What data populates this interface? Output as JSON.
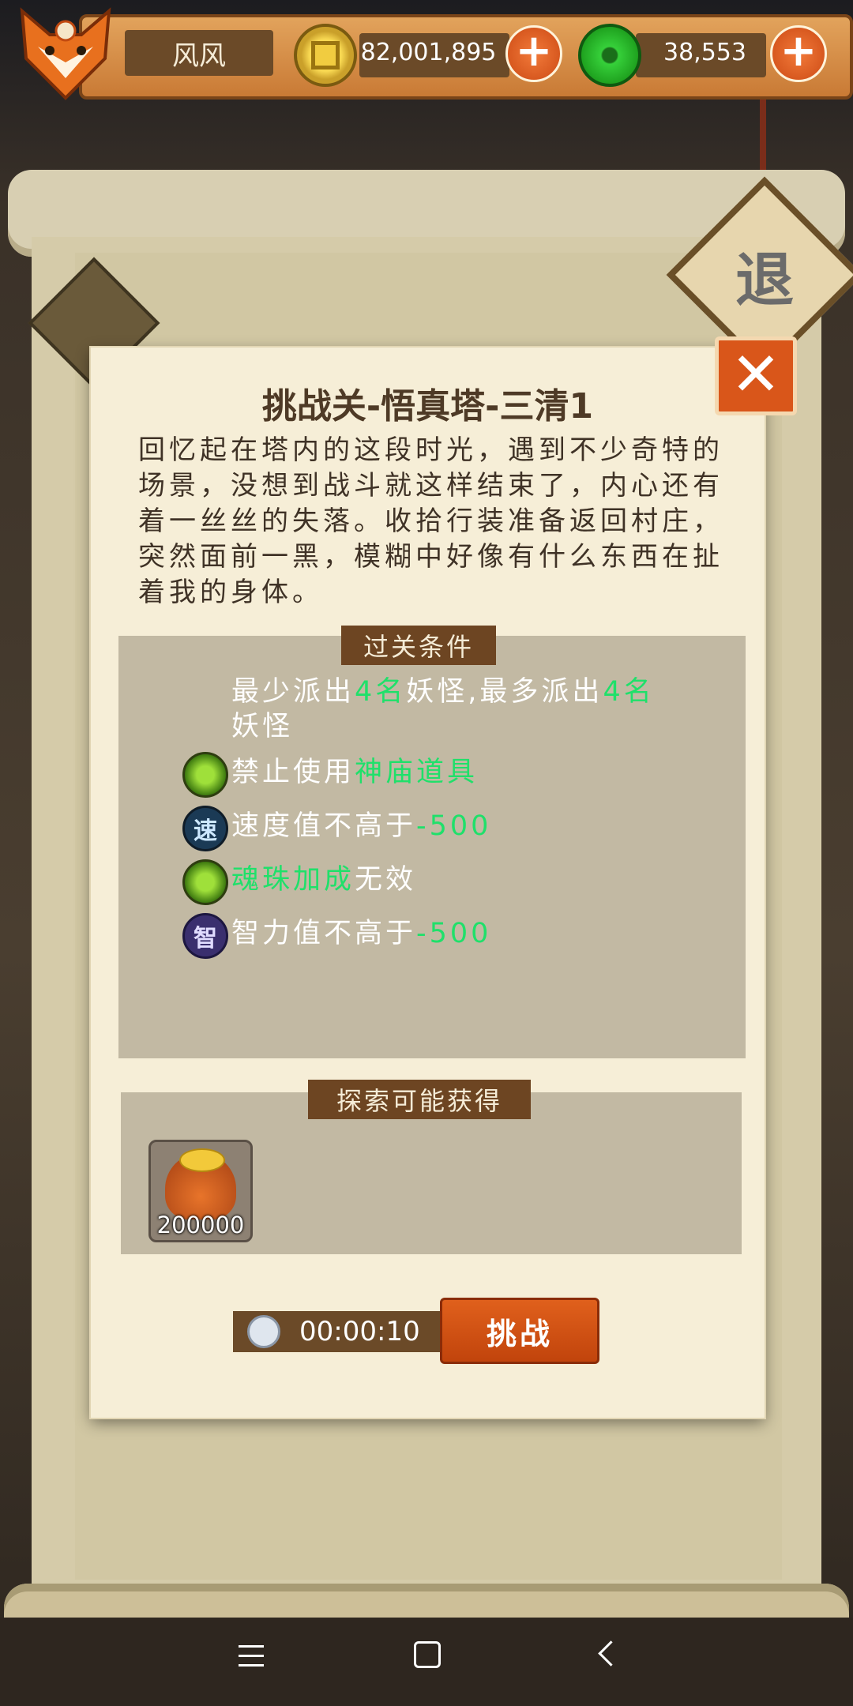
{
  "player": {
    "name": "风风",
    "gold": "82,001,895",
    "jade": "38,553",
    "add_symbol": "+"
  },
  "background": {
    "exit_label": "退"
  },
  "dialog": {
    "close_symbol": "✕",
    "title": "挑战关-悟真塔-三清1",
    "story": "回忆起在塔内的这段时光，遇到不少奇特的场景，没想到战斗就这样结束了，内心还有着一丝丝的失落。收拾行装准备返回村庄，突然面前一黑，模糊中好像有什么东西在扯着我的身体。",
    "conditions_label": "过关条件",
    "conditions": {
      "deploy": [
        "最少派出",
        "4名",
        "妖怪,最多派出",
        "4名",
        "妖怪"
      ],
      "ban": [
        "禁止使用",
        "神庙道具"
      ],
      "speed": [
        "速度值不高于",
        "-500"
      ],
      "soul": [
        "魂珠加成",
        "无效"
      ],
      "intellect": [
        "智力值不高于",
        "-500"
      ],
      "speed_icon": "速",
      "intellect_icon": "智"
    },
    "rewards_label": "探索可能获得",
    "reward_qty": "200000",
    "timer": "00:00:10",
    "challenge_label": "挑战"
  },
  "colors": {
    "highlight": "#1fe06a",
    "panel": "#c2b9a3",
    "paper": "#f6eed7",
    "accent": "#d9561a"
  }
}
